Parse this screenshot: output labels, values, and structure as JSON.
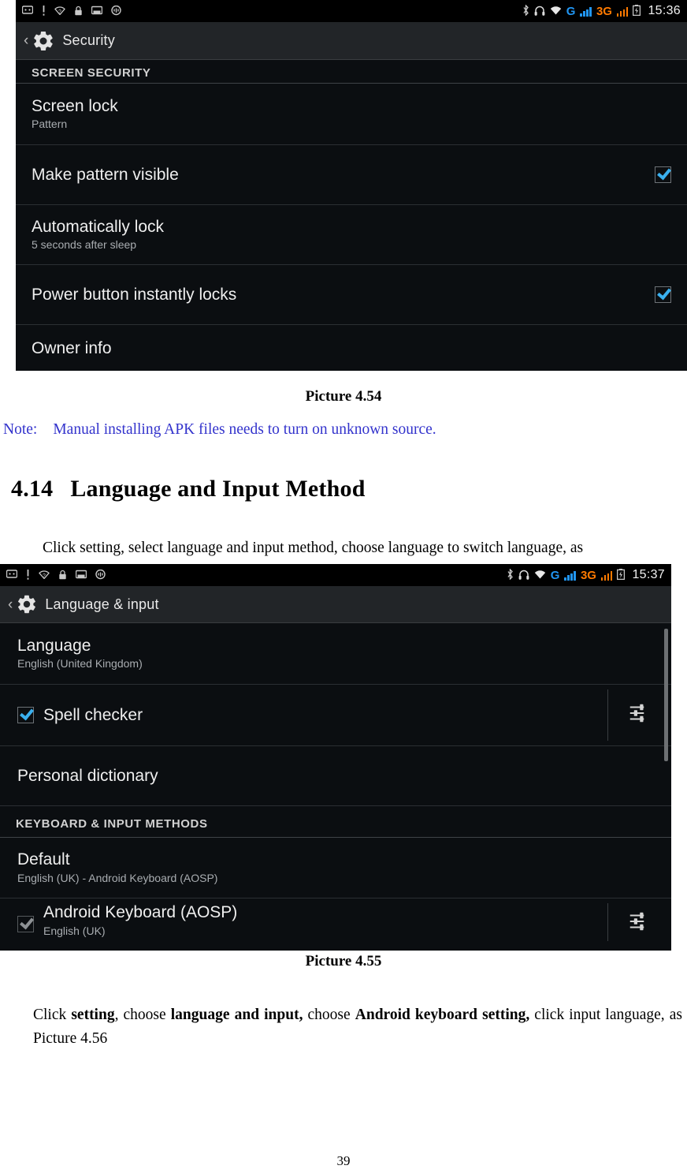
{
  "document": {
    "page_number": "39",
    "caption_1": "Picture 4.54",
    "caption_2": "Picture 4.55",
    "note": {
      "label": "Note:",
      "text": "Manual installing APK files needs to turn on unknown source.",
      "color": "#3333cc"
    },
    "heading": {
      "number": "4.14",
      "title": "Language and Input Method"
    },
    "paragraph_1": "Click setting, select language and input method, choose language to switch language, as",
    "paragraph_2": {
      "p1": "Click ",
      "b1": "setting",
      "p2": ", choose ",
      "b2": "language and input,",
      "p3": " choose ",
      "b3": "Android keyboard setting,",
      "p4": " click input language, as Picture 4.56"
    }
  },
  "screenshot_security": {
    "statusbar": {
      "left_icons": [
        "message-icon",
        "exclamation-icon",
        "wifi-question-icon",
        "lock-icon",
        "sdcard-icon",
        "speech-bubble-icon"
      ],
      "right_icons": [
        "bluetooth-icon",
        "headset-icon",
        "wifi-icon"
      ],
      "network_g_label": "G",
      "network_3g_label": "3G",
      "battery_icon": "battery-charging-icon",
      "time": "15:36"
    },
    "actionbar": {
      "back_glyph": "‹",
      "icon": "settings-gear-icon",
      "title": "Security"
    },
    "section_header": "SCREEN SECURITY",
    "rows": [
      {
        "title": "Screen lock",
        "sub": "Pattern",
        "checkbox": null
      },
      {
        "title": "Make pattern visible",
        "sub": "",
        "checkbox": "checked"
      },
      {
        "title": "Automatically lock",
        "sub": "5 seconds after sleep",
        "checkbox": null
      },
      {
        "title": "Power button instantly locks",
        "sub": "",
        "checkbox": "checked"
      },
      {
        "title": "Owner info",
        "sub": "",
        "checkbox": null
      }
    ]
  },
  "screenshot_language": {
    "statusbar": {
      "left_icons": [
        "message-icon",
        "exclamation-icon",
        "wifi-question-icon",
        "lock-icon",
        "sdcard-icon",
        "speech-bubble-icon"
      ],
      "right_icons": [
        "bluetooth-icon",
        "headset-icon",
        "wifi-icon"
      ],
      "network_g_label": "G",
      "network_3g_label": "3G",
      "battery_icon": "battery-charging-icon",
      "time": "15:37"
    },
    "actionbar": {
      "back_glyph": "‹",
      "icon": "settings-gear-icon",
      "title": "Language & input"
    },
    "rows": [
      {
        "title": "Language",
        "sub": "English (United Kingdom)"
      },
      {
        "title": "Spell checker",
        "sub": "",
        "checkbox": "checked",
        "tune": "tune-icon"
      },
      {
        "title": "Personal dictionary",
        "sub": ""
      }
    ],
    "section_header": "KEYBOARD & INPUT METHODS",
    "rows2": [
      {
        "title": "Default",
        "sub": "English (UK) - Android Keyboard (AOSP)"
      },
      {
        "title": "Android Keyboard (AOSP)",
        "sub": "English (UK)",
        "checkbox": "dim-checked",
        "tune": "tune-icon"
      }
    ]
  },
  "colors": {
    "android_bg": "#0b0e11",
    "statusbar_bg": "#000000",
    "actionbar_bg": "#222528",
    "accent_blue": "#3ab0ef",
    "note_blue": "#3333cc",
    "g_blue": "#2196f3",
    "g3_orange": "#ff7a00"
  }
}
